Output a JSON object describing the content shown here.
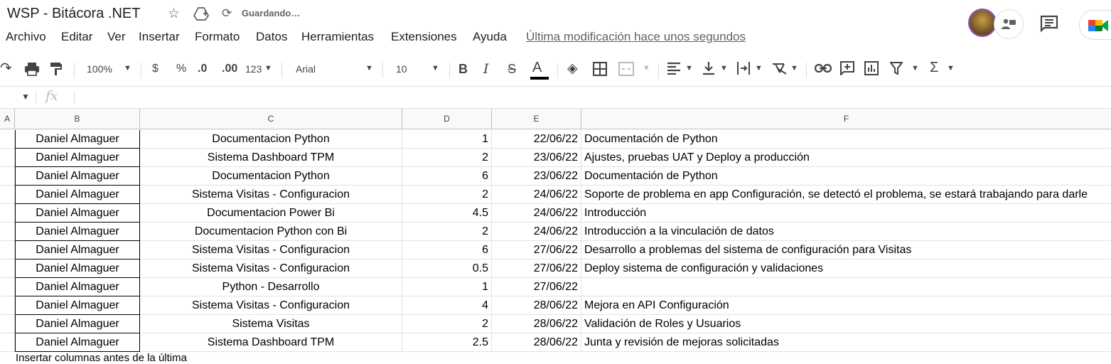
{
  "doc": {
    "title": "WSP - Bitácora .NET",
    "saving": "Guardando…"
  },
  "menu": {
    "items": [
      "Archivo",
      "Editar",
      "Ver",
      "Insertar",
      "Formato",
      "Datos",
      "Herramientas",
      "Extensiones",
      "Ayuda"
    ],
    "last_edit": "Última modificación hace unos segundos"
  },
  "toolbar": {
    "zoom": "100%",
    "currency": "$",
    "percent": "%",
    "dec_less": ".0",
    "dec_more": ".00",
    "format_123": "123",
    "font": "Arial",
    "font_size": "10",
    "bold": "B",
    "italic": "I",
    "strike": "S",
    "text_color": "A",
    "functions": "Σ"
  },
  "formula": {
    "fx": "fx",
    "value": ""
  },
  "columns": [
    "A",
    "B",
    "C",
    "D",
    "E",
    "F"
  ],
  "rows": [
    {
      "b": "Daniel Almaguer",
      "c": "Documentacion Python",
      "d": "1",
      "e": "22/06/22",
      "f": "Documentación de Python"
    },
    {
      "b": "Daniel Almaguer",
      "c": "Sistema Dashboard TPM",
      "d": "2",
      "e": "23/06/22",
      "f": "Ajustes, pruebas UAT y Deploy a producción"
    },
    {
      "b": "Daniel Almaguer",
      "c": "Documentacion Python",
      "d": "6",
      "e": "23/06/22",
      "f": "Documentación de Python"
    },
    {
      "b": "Daniel Almaguer",
      "c": "Sistema Visitas - Configuracion",
      "d": "2",
      "e": "24/06/22",
      "f": "Soporte de problema en app Configuración, se detectó el problema, se estará trabajando para darle"
    },
    {
      "b": "Daniel Almaguer",
      "c": "Documentacion Power Bi",
      "d": "4.5",
      "e": "24/06/22",
      "f": "Introducción"
    },
    {
      "b": "Daniel Almaguer",
      "c": "Documentacion Python con Bi",
      "d": "2",
      "e": "24/06/22",
      "f": "Introducción a la vinculación de datos"
    },
    {
      "b": "Daniel Almaguer",
      "c": "Sistema Visitas - Configuracion",
      "d": "6",
      "e": "27/06/22",
      "f": "Desarrollo a problemas del sistema de configuración para Visitas"
    },
    {
      "b": "Daniel Almaguer",
      "c": "Sistema Visitas - Configuracion",
      "d": "0.5",
      "e": "27/06/22",
      "f": "Deploy sistema de configuración y validaciones"
    },
    {
      "b": "Daniel Almaguer",
      "c": "Python - Desarrollo",
      "d": "1",
      "e": "27/06/22",
      "f": ""
    },
    {
      "b": "Daniel Almaguer",
      "c": "Sistema Visitas - Configuracion",
      "d": "4",
      "e": "28/06/22",
      "f": "Mejora en API Configuración"
    },
    {
      "b": "Daniel Almaguer",
      "c": "Sistema Visitas",
      "d": "2",
      "e": "28/06/22",
      "f": "Validación de Roles y Usuarios"
    },
    {
      "b": "Daniel Almaguer",
      "c": "Sistema Dashboard TPM",
      "d": "2.5",
      "e": "28/06/22",
      "f": "Junta y revisión de mejoras solicitadas"
    }
  ],
  "insert_hint": "Insertar columnas antes de la última"
}
